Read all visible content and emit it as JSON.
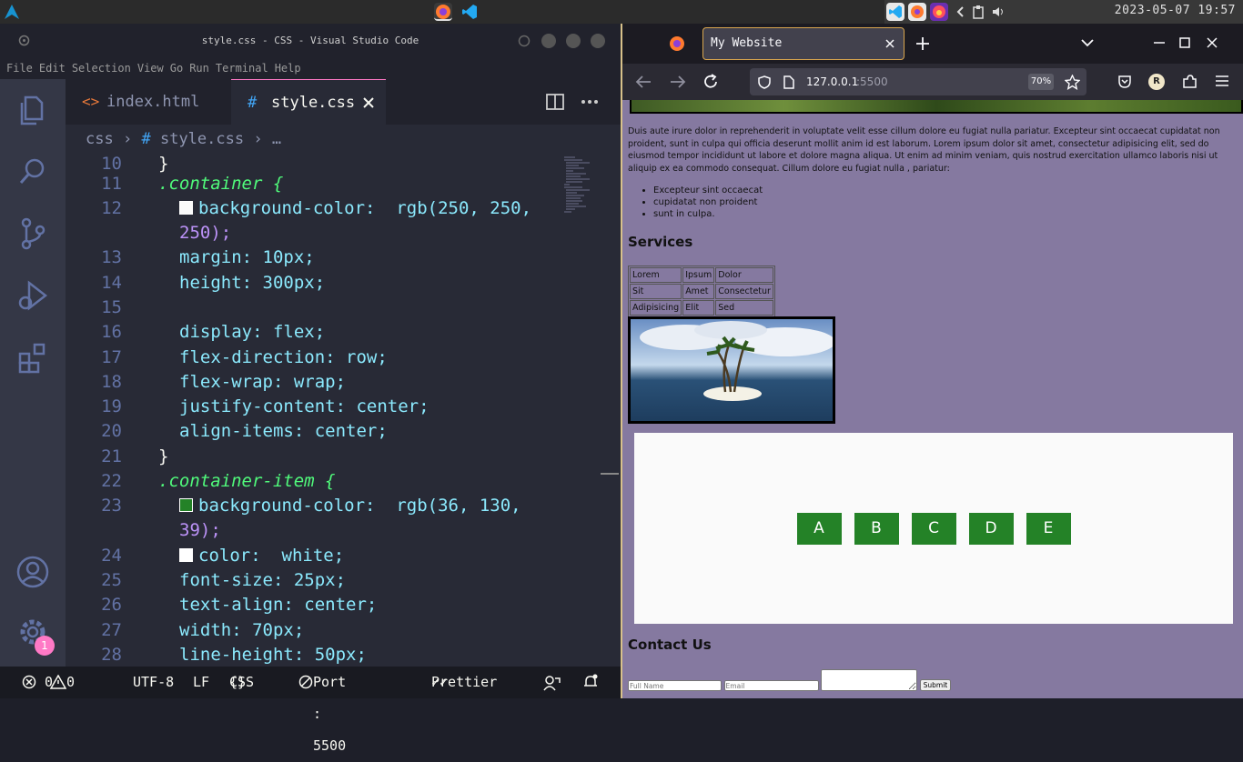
{
  "taskbar": {
    "clock": "2023-05-07  19:57"
  },
  "vscode": {
    "title": "style.css - CSS - Visual Studio Code",
    "menu": [
      "File",
      "Edit",
      "Selection",
      "View",
      "Go",
      "Run",
      "Terminal",
      "Help"
    ],
    "tabs": [
      {
        "label": "index.html",
        "icon": "html-icon",
        "active": false
      },
      {
        "label": "style.css",
        "icon": "hash-icon",
        "active": true
      }
    ],
    "breadcrumb": {
      "folder": "css",
      "file": "style.css",
      "more": "…"
    },
    "settings_badge": "1",
    "lines": [
      {
        "n": "10",
        "text": "}"
      },
      {
        "n": "11",
        "text": ".container {"
      },
      {
        "n": "12",
        "text": "background-color:  rgb(250, 250,"
      },
      {
        "n": "",
        "text": "250);"
      },
      {
        "n": "13",
        "text": "margin: 10px;"
      },
      {
        "n": "14",
        "text": "height: 300px;"
      },
      {
        "n": "15",
        "text": ""
      },
      {
        "n": "16",
        "text": "display: flex;"
      },
      {
        "n": "17",
        "text": "flex-direction: row;"
      },
      {
        "n": "18",
        "text": "flex-wrap: wrap;"
      },
      {
        "n": "19",
        "text": "justify-content: center;"
      },
      {
        "n": "20",
        "text": "align-items: center;"
      },
      {
        "n": "21",
        "text": "}"
      },
      {
        "n": "22",
        "text": ".container-item {"
      },
      {
        "n": "23",
        "text": "background-color:  rgb(36, 130,"
      },
      {
        "n": "",
        "text": "39);"
      },
      {
        "n": "24",
        "text": "color:  white;"
      },
      {
        "n": "25",
        "text": "font-size: 25px;"
      },
      {
        "n": "26",
        "text": "text-align: center;"
      },
      {
        "n": "27",
        "text": "width: 70px;"
      },
      {
        "n": "28",
        "text": "line-height: 50px;"
      }
    ],
    "status": {
      "errors": "0",
      "warnings": "0",
      "encoding": "UTF-8",
      "eol": "LF",
      "language": "CSS",
      "port": "Port : 5500",
      "formatter": "Prettier"
    },
    "swatch_colors": {
      "white": "#fafafa",
      "green": "#248227"
    }
  },
  "firefox": {
    "tab_title": "My Website",
    "url_host": "127.0.0.1",
    "url_port": ":5500",
    "zoom": "70%",
    "profile_initial": "R",
    "page": {
      "paragraph": "Duis aute irure dolor in reprehenderit in voluptate velit esse cillum dolore eu fugiat nulla pariatur. Excepteur sint occaecat cupidatat non proident, sunt in culpa qui officia deserunt mollit anim id est laborum. Lorem ipsum dolor sit amet, consectetur adipisicing elit, sed do eiusmod tempor incididunt ut labore et dolore magna aliqua. Ut enim ad minim veniam, quis nostrud exercitation ullamco laboris nisi ut aliquip ex ea commodo consequat. Cillum dolore eu fugiat nulla , pariatur:",
      "list": [
        "Excepteur sint occaecat",
        "cupidatat non proident",
        "sunt in culpa."
      ],
      "services_heading": "Services",
      "table": [
        [
          "Lorem",
          "Ipsum",
          "Dolor"
        ],
        [
          "Sit",
          "Amet",
          "Consectetur"
        ],
        [
          "Adipisicing",
          "Elit",
          "Sed"
        ]
      ],
      "items": [
        "A",
        "B",
        "C",
        "D",
        "E"
      ],
      "contact_heading": "Contact Us",
      "form": {
        "name_placeholder": "Full Name",
        "email_placeholder": "Email",
        "submit": "Submit"
      },
      "page_bg": "#8579a0",
      "item_color": "#248227"
    }
  }
}
